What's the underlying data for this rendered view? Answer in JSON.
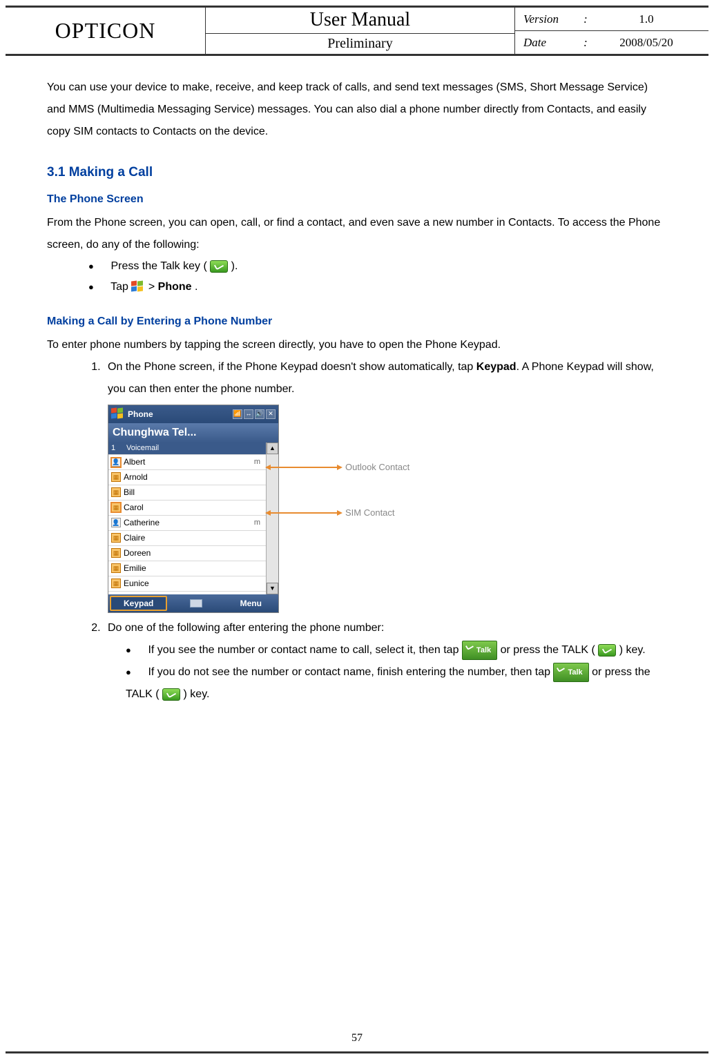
{
  "header": {
    "brand": "OPTICON",
    "title": "User Manual",
    "subtitle": "Preliminary",
    "version_label": "Version",
    "version_value": "1.0",
    "date_label": "Date",
    "date_value": "2008/05/20"
  },
  "intro": "You can use your device to make, receive, and keep track of calls, and send text messages (SMS, Short Message Service) and MMS (Multimedia Messaging Service) messages. You can also dial a phone number directly from Contacts, and easily copy SIM contacts to Contacts on the device.",
  "section_31": {
    "heading": "3.1 Making a Call",
    "sub_phone_screen": "The Phone Screen",
    "phone_screen_text": "From the Phone screen, you can open, call, or find a contact, and even save a new number in Contacts. To access the Phone screen, do any of the following:",
    "bullet_press_talk_prefix": "Press the Talk key (",
    "bullet_press_talk_suffix": ").",
    "bullet_tap_prefix": "Tap ",
    "bullet_tap_gt_phone_gt": " > ",
    "bullet_tap_phone": "Phone",
    "bullet_tap_suffix": "."
  },
  "making_call_number": {
    "heading": "Making a Call by Entering a Phone Number",
    "intro": "To enter phone numbers by tapping the screen directly, you have to open the Phone Keypad.",
    "step1_part1": "On the Phone screen, if the Phone Keypad doesn't show automatically, tap ",
    "step1_keypad": "Keypad",
    "step1_part2": ". A Phone Keypad will show, you can then enter the phone number.",
    "step2_intro": "Do one of the following after entering the phone number:",
    "step2_b1_p1": "If you see the number or contact name to call, select it, then tap ",
    "step2_b1_p2": " or press the TALK (",
    "step2_b1_p3": ") key.",
    "step2_b2_p1": "If you do not see the number or contact name, finish entering the number, then tap ",
    "step2_b2_p2": " or press the TALK (",
    "step2_b2_p3": ") key."
  },
  "annotations": {
    "outlook": "Outlook Contact",
    "sim": "SIM Contact"
  },
  "talk_btn_label": "Talk",
  "phone": {
    "app_title": "Phone",
    "carrier": "Chunghwa Tel...",
    "list_header_num": "1",
    "list_header_label": "Voicemail",
    "contacts": [
      {
        "icon": "outlook",
        "name": "Albert",
        "m": "m"
      },
      {
        "icon": "sim",
        "name": "Arnold",
        "m": ""
      },
      {
        "icon": "sim",
        "name": "Bill",
        "m": ""
      },
      {
        "icon": "sim",
        "name": "Carol",
        "m": ""
      },
      {
        "icon": "outlook",
        "name": "Catherine",
        "m": "m"
      },
      {
        "icon": "sim",
        "name": "Claire",
        "m": ""
      },
      {
        "icon": "sim",
        "name": "Doreen",
        "m": ""
      },
      {
        "icon": "sim",
        "name": "Emilie",
        "m": ""
      },
      {
        "icon": "sim",
        "name": "Eunice",
        "m": ""
      }
    ],
    "softkey_left": "Keypad",
    "softkey_right": "Menu"
  },
  "page_number": "57"
}
